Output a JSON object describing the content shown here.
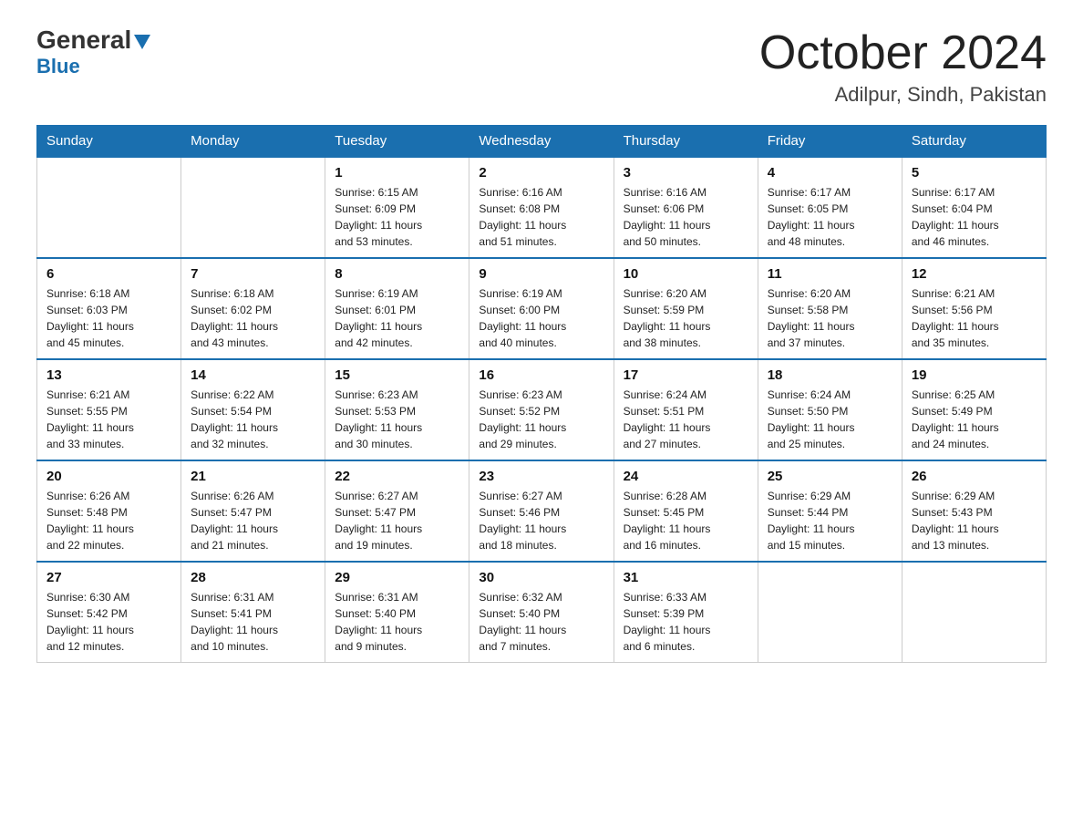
{
  "header": {
    "logo_general": "General",
    "logo_blue": "Blue",
    "month_title": "October 2024",
    "location": "Adilpur, Sindh, Pakistan"
  },
  "days_of_week": [
    "Sunday",
    "Monday",
    "Tuesday",
    "Wednesday",
    "Thursday",
    "Friday",
    "Saturday"
  ],
  "weeks": [
    [
      {
        "day": "",
        "info": ""
      },
      {
        "day": "",
        "info": ""
      },
      {
        "day": "1",
        "info": "Sunrise: 6:15 AM\nSunset: 6:09 PM\nDaylight: 11 hours\nand 53 minutes."
      },
      {
        "day": "2",
        "info": "Sunrise: 6:16 AM\nSunset: 6:08 PM\nDaylight: 11 hours\nand 51 minutes."
      },
      {
        "day": "3",
        "info": "Sunrise: 6:16 AM\nSunset: 6:06 PM\nDaylight: 11 hours\nand 50 minutes."
      },
      {
        "day": "4",
        "info": "Sunrise: 6:17 AM\nSunset: 6:05 PM\nDaylight: 11 hours\nand 48 minutes."
      },
      {
        "day": "5",
        "info": "Sunrise: 6:17 AM\nSunset: 6:04 PM\nDaylight: 11 hours\nand 46 minutes."
      }
    ],
    [
      {
        "day": "6",
        "info": "Sunrise: 6:18 AM\nSunset: 6:03 PM\nDaylight: 11 hours\nand 45 minutes."
      },
      {
        "day": "7",
        "info": "Sunrise: 6:18 AM\nSunset: 6:02 PM\nDaylight: 11 hours\nand 43 minutes."
      },
      {
        "day": "8",
        "info": "Sunrise: 6:19 AM\nSunset: 6:01 PM\nDaylight: 11 hours\nand 42 minutes."
      },
      {
        "day": "9",
        "info": "Sunrise: 6:19 AM\nSunset: 6:00 PM\nDaylight: 11 hours\nand 40 minutes."
      },
      {
        "day": "10",
        "info": "Sunrise: 6:20 AM\nSunset: 5:59 PM\nDaylight: 11 hours\nand 38 minutes."
      },
      {
        "day": "11",
        "info": "Sunrise: 6:20 AM\nSunset: 5:58 PM\nDaylight: 11 hours\nand 37 minutes."
      },
      {
        "day": "12",
        "info": "Sunrise: 6:21 AM\nSunset: 5:56 PM\nDaylight: 11 hours\nand 35 minutes."
      }
    ],
    [
      {
        "day": "13",
        "info": "Sunrise: 6:21 AM\nSunset: 5:55 PM\nDaylight: 11 hours\nand 33 minutes."
      },
      {
        "day": "14",
        "info": "Sunrise: 6:22 AM\nSunset: 5:54 PM\nDaylight: 11 hours\nand 32 minutes."
      },
      {
        "day": "15",
        "info": "Sunrise: 6:23 AM\nSunset: 5:53 PM\nDaylight: 11 hours\nand 30 minutes."
      },
      {
        "day": "16",
        "info": "Sunrise: 6:23 AM\nSunset: 5:52 PM\nDaylight: 11 hours\nand 29 minutes."
      },
      {
        "day": "17",
        "info": "Sunrise: 6:24 AM\nSunset: 5:51 PM\nDaylight: 11 hours\nand 27 minutes."
      },
      {
        "day": "18",
        "info": "Sunrise: 6:24 AM\nSunset: 5:50 PM\nDaylight: 11 hours\nand 25 minutes."
      },
      {
        "day": "19",
        "info": "Sunrise: 6:25 AM\nSunset: 5:49 PM\nDaylight: 11 hours\nand 24 minutes."
      }
    ],
    [
      {
        "day": "20",
        "info": "Sunrise: 6:26 AM\nSunset: 5:48 PM\nDaylight: 11 hours\nand 22 minutes."
      },
      {
        "day": "21",
        "info": "Sunrise: 6:26 AM\nSunset: 5:47 PM\nDaylight: 11 hours\nand 21 minutes."
      },
      {
        "day": "22",
        "info": "Sunrise: 6:27 AM\nSunset: 5:47 PM\nDaylight: 11 hours\nand 19 minutes."
      },
      {
        "day": "23",
        "info": "Sunrise: 6:27 AM\nSunset: 5:46 PM\nDaylight: 11 hours\nand 18 minutes."
      },
      {
        "day": "24",
        "info": "Sunrise: 6:28 AM\nSunset: 5:45 PM\nDaylight: 11 hours\nand 16 minutes."
      },
      {
        "day": "25",
        "info": "Sunrise: 6:29 AM\nSunset: 5:44 PM\nDaylight: 11 hours\nand 15 minutes."
      },
      {
        "day": "26",
        "info": "Sunrise: 6:29 AM\nSunset: 5:43 PM\nDaylight: 11 hours\nand 13 minutes."
      }
    ],
    [
      {
        "day": "27",
        "info": "Sunrise: 6:30 AM\nSunset: 5:42 PM\nDaylight: 11 hours\nand 12 minutes."
      },
      {
        "day": "28",
        "info": "Sunrise: 6:31 AM\nSunset: 5:41 PM\nDaylight: 11 hours\nand 10 minutes."
      },
      {
        "day": "29",
        "info": "Sunrise: 6:31 AM\nSunset: 5:40 PM\nDaylight: 11 hours\nand 9 minutes."
      },
      {
        "day": "30",
        "info": "Sunrise: 6:32 AM\nSunset: 5:40 PM\nDaylight: 11 hours\nand 7 minutes."
      },
      {
        "day": "31",
        "info": "Sunrise: 6:33 AM\nSunset: 5:39 PM\nDaylight: 11 hours\nand 6 minutes."
      },
      {
        "day": "",
        "info": ""
      },
      {
        "day": "",
        "info": ""
      }
    ]
  ]
}
